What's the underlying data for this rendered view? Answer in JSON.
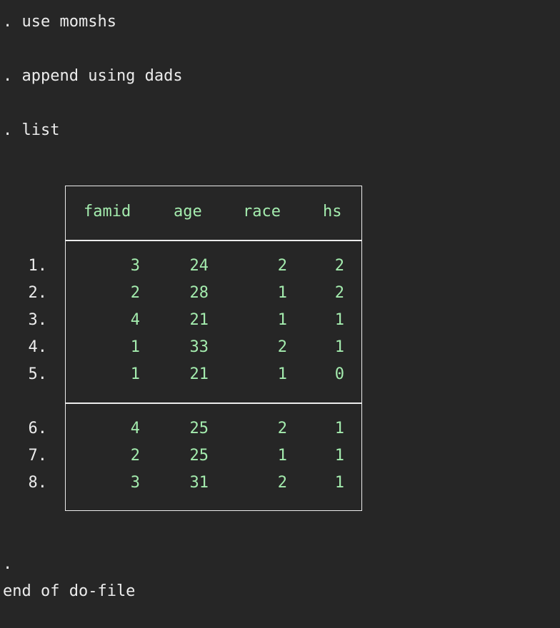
{
  "commands": {
    "c1": ". use momshs",
    "c2": ". append using dads",
    "c3": ". list"
  },
  "table": {
    "headers": [
      "famid",
      "age",
      "race",
      "hs"
    ],
    "rows": [
      {
        "n": "1.",
        "famid": "3",
        "age": "24",
        "race": "2",
        "hs": "2"
      },
      {
        "n": "2.",
        "famid": "2",
        "age": "28",
        "race": "1",
        "hs": "2"
      },
      {
        "n": "3.",
        "famid": "4",
        "age": "21",
        "race": "1",
        "hs": "1"
      },
      {
        "n": "4.",
        "famid": "1",
        "age": "33",
        "race": "2",
        "hs": "1"
      },
      {
        "n": "5.",
        "famid": "1",
        "age": "21",
        "race": "1",
        "hs": "0"
      },
      {
        "n": "6.",
        "famid": "4",
        "age": "25",
        "race": "2",
        "hs": "1"
      },
      {
        "n": "7.",
        "famid": "2",
        "age": "25",
        "race": "1",
        "hs": "1"
      },
      {
        "n": "8.",
        "famid": "3",
        "age": "31",
        "race": "2",
        "hs": "1"
      }
    ]
  },
  "footer": {
    "dot": ".",
    "end": "end of do-file"
  },
  "colors": {
    "background": "#262626",
    "text": "#ececec",
    "value": "#a4ecae"
  }
}
